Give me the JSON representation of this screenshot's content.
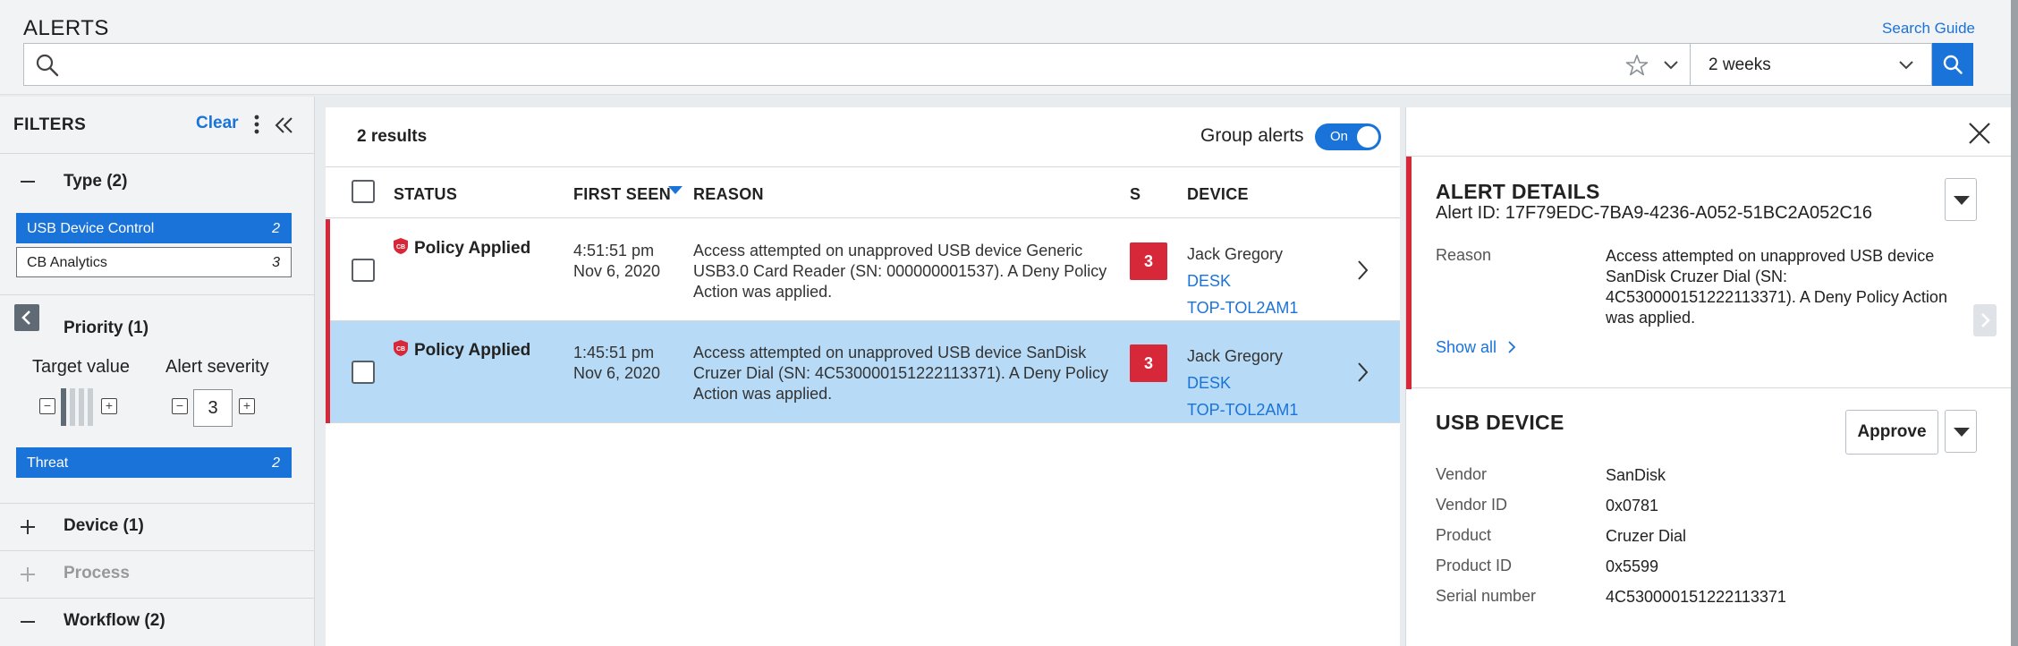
{
  "header": {
    "title": "ALERTS",
    "search_guide": "Search Guide",
    "search_value": "",
    "time_range": "2 weeks"
  },
  "filters": {
    "title": "FILTERS",
    "clear_label": "Clear",
    "sections": {
      "type": {
        "title": "Type (2)",
        "options": [
          {
            "label": "USB Device Control",
            "count": "2",
            "selected": true
          },
          {
            "label": "CB Analytics",
            "count": "3",
            "selected": false
          }
        ]
      },
      "priority": {
        "title": "Priority (1)",
        "target_value_label": "Target value",
        "alert_severity_label": "Alert severity",
        "severity_value": "3",
        "options": [
          {
            "label": "Threat",
            "count": "2",
            "selected": true
          }
        ]
      },
      "device": {
        "title": "Device (1)"
      },
      "process": {
        "title": "Process"
      },
      "workflow": {
        "title": "Workflow (2)"
      }
    }
  },
  "results": {
    "count_label": "2 results",
    "group_alerts_label": "Group alerts",
    "toggle_label": "On",
    "columns": {
      "status": "STATUS",
      "first_seen": "FIRST SEEN",
      "reason": "REASON",
      "severity": "S",
      "device": "DEVICE"
    },
    "rows": [
      {
        "status": "Policy Applied",
        "time": "4:51:51 pm",
        "date": "Nov 6, 2020",
        "reason": "Access attempted on unapproved USB device Generic USB3.0 Card Reader (SN: 000000001537). A Deny Policy Action was applied.",
        "severity": "3",
        "user": "Jack Gregory",
        "device_part1": "DESK",
        "device_part2": "TOP-TOL2AM1",
        "selected": false
      },
      {
        "status": "Policy Applied",
        "time": "1:45:51 pm",
        "date": "Nov 6, 2020",
        "reason": "Access attempted on unapproved USB device SanDisk Cruzer Dial (SN: 4C530000151222113371). A Deny Policy Action was applied.",
        "severity": "3",
        "user": "Jack Gregory",
        "device_part1": "DESK",
        "device_part2": "TOP-TOL2AM1",
        "selected": true
      }
    ]
  },
  "details": {
    "alert_details_title": "ALERT DETAILS",
    "alert_id": "Alert ID: 17F79EDC-7BA9-4236-A052-51BC2A052C16",
    "reason_key": "Reason",
    "reason_value": "Access attempted on unapproved USB device SanDisk Cruzer Dial (SN: 4C530000151222113371). A Deny Policy Action was applied.",
    "show_all": "Show all",
    "usb_title": "USB DEVICE",
    "approve_label": "Approve",
    "usb_fields": [
      {
        "key": "Vendor",
        "value": "SanDisk"
      },
      {
        "key": "Vendor ID",
        "value": "0x0781"
      },
      {
        "key": "Product",
        "value": "Cruzer Dial"
      },
      {
        "key": "Product ID",
        "value": "0x5599"
      },
      {
        "key": "Serial number",
        "value": "4C530000151222113371"
      }
    ]
  },
  "colors": {
    "accent": "#1a73d9",
    "danger": "#d62839",
    "selected_row": "#b7dbf6"
  }
}
